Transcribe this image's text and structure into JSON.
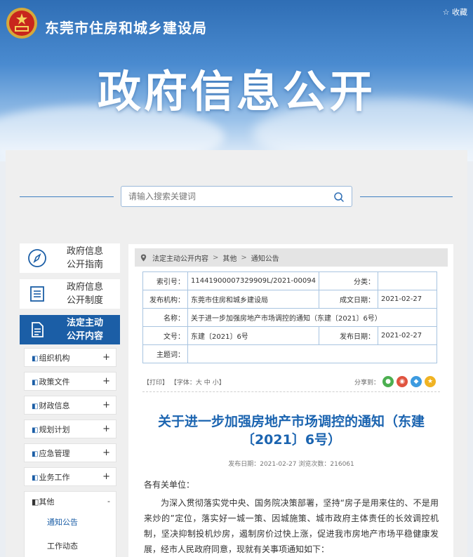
{
  "header": {
    "org_name": "东莞市住房和城乡建设局",
    "banner": "政府信息公开",
    "favorite": "☆ 收藏"
  },
  "search": {
    "placeholder": "请输入搜索关键词"
  },
  "sidebar": {
    "tiles": [
      {
        "line1": "政府信息",
        "line2": "公开指南",
        "icon": "compass-icon"
      },
      {
        "line1": "政府信息",
        "line2": "公开制度",
        "icon": "document-list-icon"
      },
      {
        "line1": "法定主动",
        "line2": "公开内容",
        "icon": "document-icon",
        "active": true
      }
    ],
    "prefix": "◧",
    "menu": [
      {
        "label": "组织机构",
        "sign": "+"
      },
      {
        "label": "政策文件",
        "sign": "+"
      },
      {
        "label": "财政信息",
        "sign": "+"
      },
      {
        "label": "规划计划",
        "sign": "+"
      },
      {
        "label": "应急管理",
        "sign": "+"
      },
      {
        "label": "业务工作",
        "sign": "+"
      }
    ],
    "open_menu": {
      "label": "其他",
      "sign": "-",
      "subs": [
        "通知公告",
        "工作动态"
      ]
    }
  },
  "breadcrumb": [
    "法定主动公开内容",
    "其他",
    "通知公告"
  ],
  "breadcrumb_sep": ">",
  "meta": {
    "index_label": "索引号：",
    "index_value": "11441900007329909L/2021-00094",
    "category_label": "分类：",
    "category_value": "",
    "publisher_label": "发布机构：",
    "publisher_value": "东莞市住房和城乡建设局",
    "created_label": "成文日期：",
    "created_value": "2021-02-27",
    "name_label": "名称：",
    "name_value": "关于进一步加强房地产市场调控的通知（东建〔2021〕6号）",
    "docno_label": "文号：",
    "docno_value": "东建〔2021〕6号",
    "pubdate_label": "发布日期：",
    "pubdate_value": "2021-02-27",
    "subject_label": "主题词：",
    "subject_value": ""
  },
  "tools": {
    "print": "【打印】",
    "font_label": "【字体：",
    "big": "大",
    "mid": "中",
    "small": "小",
    "close": "】"
  },
  "share": {
    "label": "分享到：",
    "icons": [
      {
        "name": "wechat-icon",
        "glyph": "●",
        "color": "#4caf50"
      },
      {
        "name": "weibo-icon",
        "glyph": "◉",
        "color": "#e0533f"
      },
      {
        "name": "qq-icon",
        "glyph": "◆",
        "color": "#3d9be0"
      },
      {
        "name": "qzone-icon",
        "glyph": "★",
        "color": "#f0b323"
      }
    ]
  },
  "article": {
    "title": "关于进一步加强房地产市场调控的通知（东建〔2021〕6号）",
    "publish_info": "发布日期：2021-02-27   浏览次数：216061",
    "salutation": "各有关单位：",
    "paragraph": "为深入贯彻落实党中央、国务院决策部署，坚持“房子是用来住的、不是用来炒的”定位，落实好一城一策、因城施策、城市政府主体责任的长效调控机制，坚决抑制投机炒房，遏制房价过快上涨，促进我市房地产市场平稳健康发展，经市人民政府同意，现就有关事项通知如下："
  }
}
